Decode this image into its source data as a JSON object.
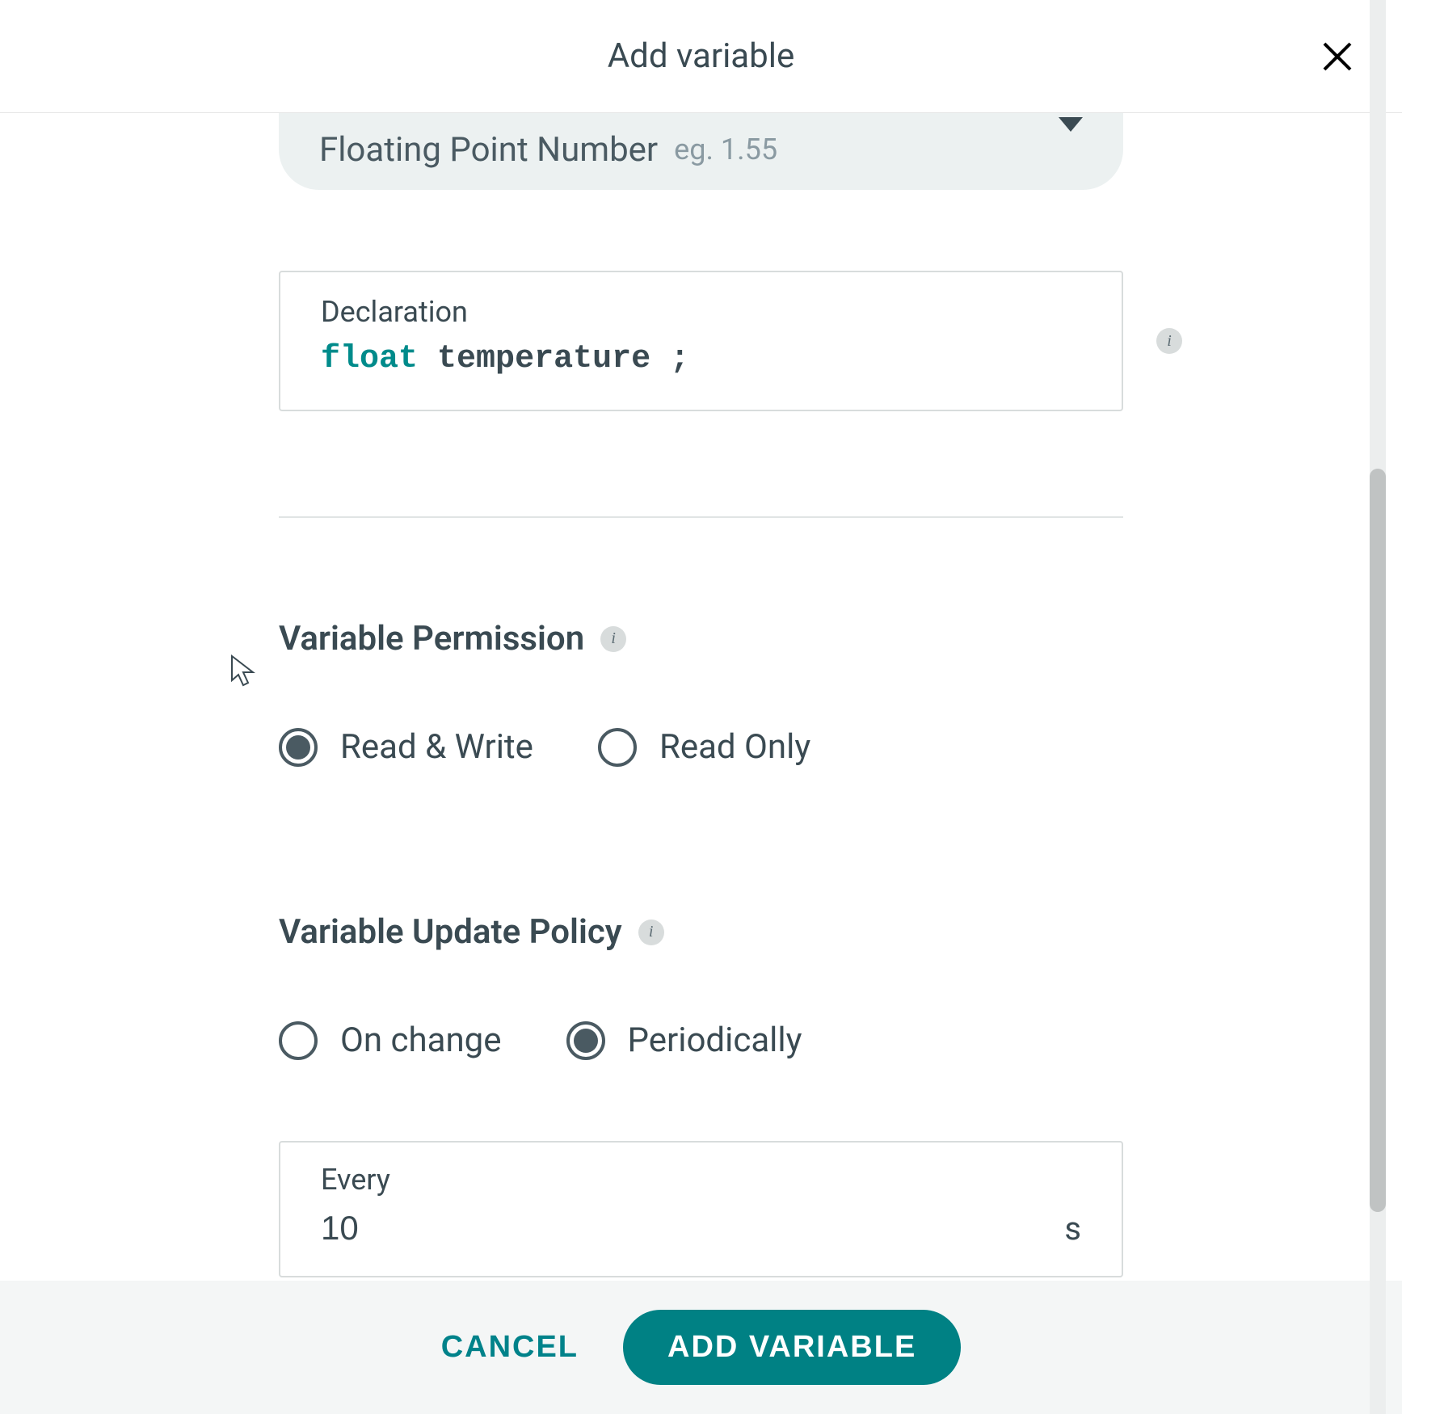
{
  "modal": {
    "title": "Add variable"
  },
  "typeSelect": {
    "label": "Floating Point Number",
    "hint": "eg. 1.55"
  },
  "declaration": {
    "label": "Declaration",
    "type": "float",
    "name": "temperature ;"
  },
  "permission": {
    "title": "Variable Permission",
    "options": {
      "rw": "Read & Write",
      "ro": "Read Only"
    }
  },
  "updatePolicy": {
    "title": "Variable Update Policy",
    "options": {
      "onchange": "On change",
      "periodic": "Periodically"
    }
  },
  "interval": {
    "label": "Every",
    "value": "10",
    "unit": "s"
  },
  "footer": {
    "cancel": "CANCEL",
    "submit": "ADD VARIABLE"
  }
}
